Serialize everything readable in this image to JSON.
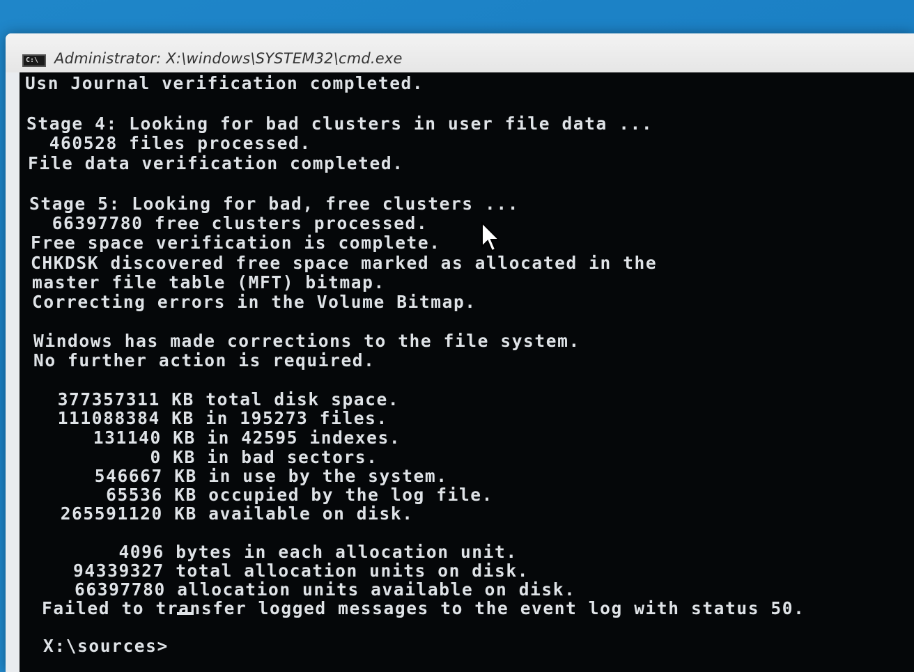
{
  "window": {
    "title": "Administrator: X:\\windows\\SYSTEM32\\cmd.exe",
    "icon_label": "C:\\"
  },
  "console": {
    "lines": [
      "Usn Journal verification completed.",
      "",
      "Stage 4: Looking for bad clusters in user file data ...",
      "  460528 files processed.",
      "File data verification completed.",
      "",
      "Stage 5: Looking for bad, free clusters ...",
      "  66397780 free clusters processed.",
      "Free space verification is complete.",
      "CHKDSK discovered free space marked as allocated in the",
      "master file table (MFT) bitmap.",
      "Correcting errors in the Volume Bitmap.",
      "",
      "Windows has made corrections to the file system.",
      "No further action is required.",
      "",
      "  377357311 KB total disk space.",
      "  111088384 KB in 195273 files.",
      "     131140 KB in 42595 indexes.",
      "          0 KB in bad sectors.",
      "     546667 KB in use by the system.",
      "      65536 KB occupied by the log file.",
      "  265591120 KB available on disk.",
      "",
      "       4096 bytes in each allocation unit.",
      "   94339327 total allocation units on disk.",
      "   66397780 allocation units available on disk.",
      "Failed to transfer logged messages to the event log with status 50.",
      "",
      "X:\\sources>"
    ]
  },
  "colors": {
    "desktop": "#1f86c9",
    "console_bg": "#050709",
    "console_text": "#dfe3e7"
  }
}
